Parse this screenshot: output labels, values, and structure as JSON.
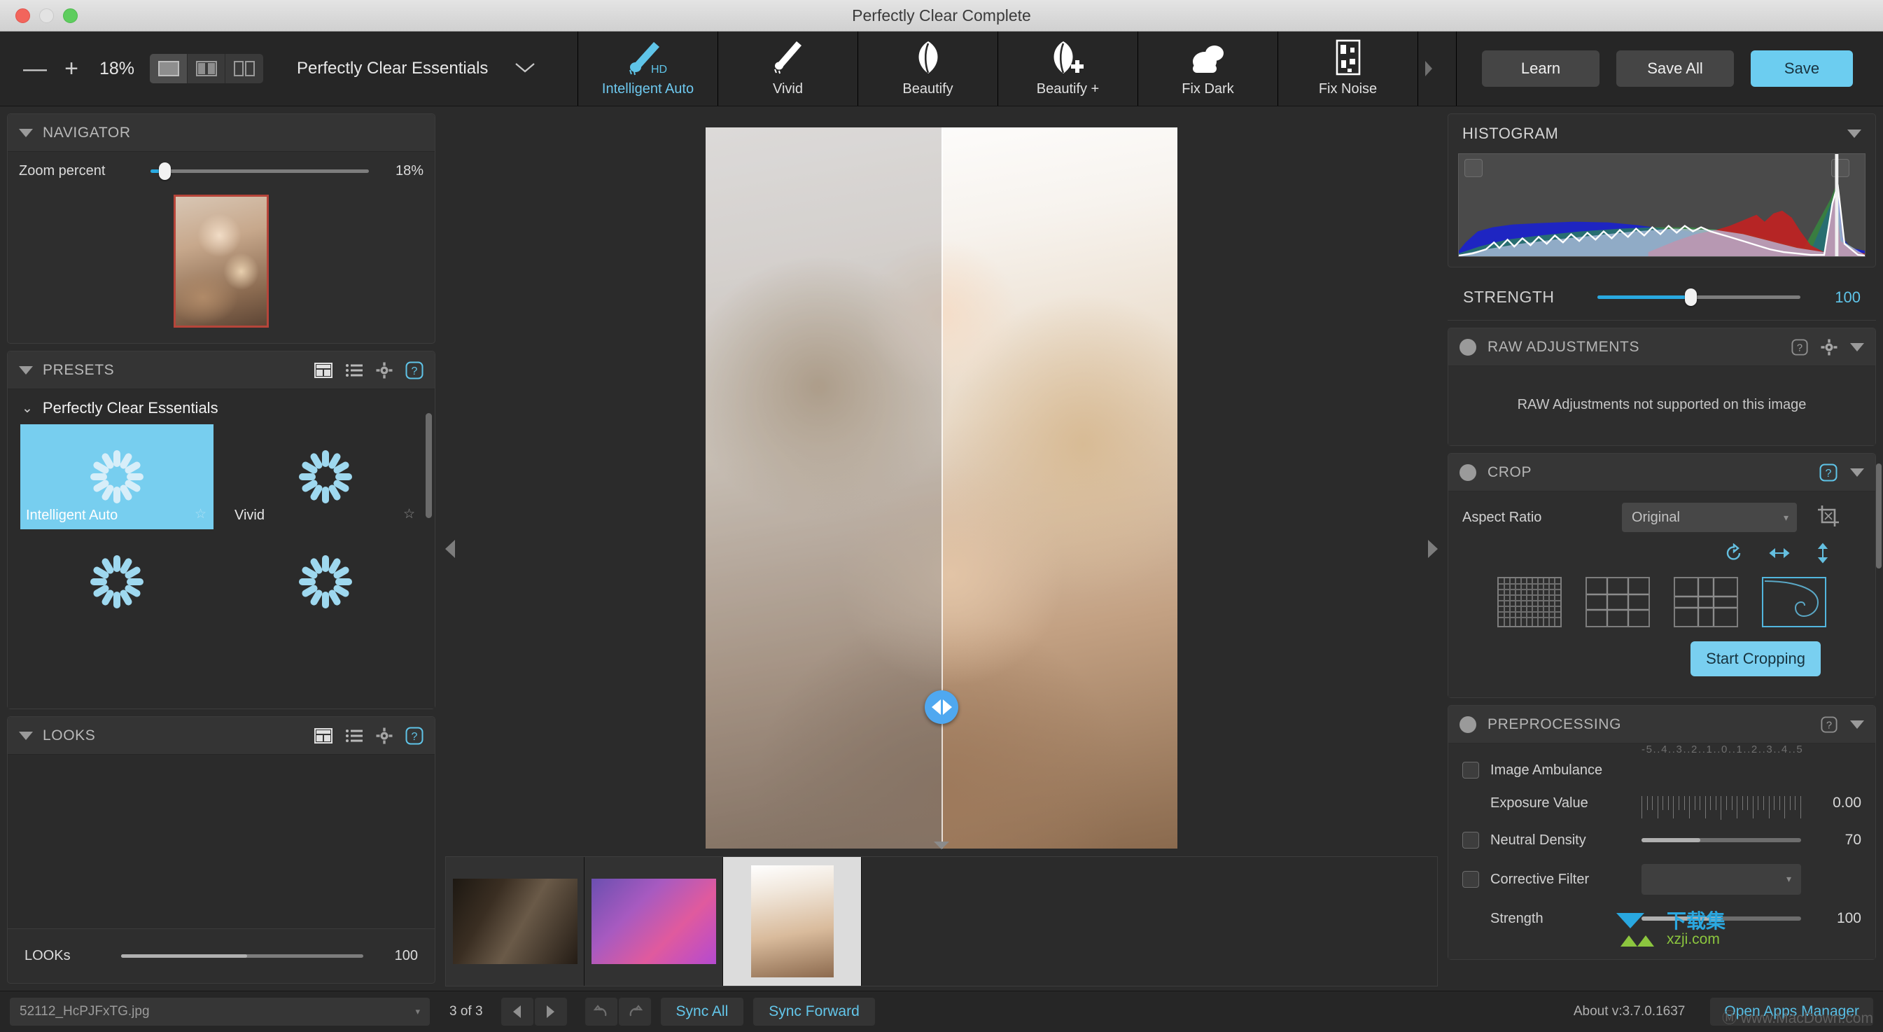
{
  "window": {
    "title": "Perfectly Clear Complete",
    "traffic": [
      "close",
      "minimize",
      "maximize"
    ]
  },
  "toolbar": {
    "zoom_out_label": "—",
    "zoom_in_label": "+",
    "zoom_percent": "18%",
    "view_modes": [
      {
        "name": "single-view",
        "active": true
      },
      {
        "name": "split-view",
        "active": false
      },
      {
        "name": "side-by-side-view",
        "active": false
      }
    ],
    "preset_name": "Perfectly Clear Essentials",
    "tabs": [
      {
        "label": "Intelligent Auto",
        "icon": "brush-hd-icon",
        "active": true
      },
      {
        "label": "Vivid",
        "icon": "brush-icon",
        "active": false
      },
      {
        "label": "Beautify",
        "icon": "leaf-icon",
        "active": false
      },
      {
        "label": "Beautify +",
        "icon": "leaf-plus-icon",
        "active": false
      },
      {
        "label": "Fix Dark",
        "icon": "clouds-icon",
        "active": false
      },
      {
        "label": "Fix Noise",
        "icon": "noise-icon",
        "active": false
      }
    ],
    "buttons": {
      "learn": "Learn",
      "save_all": "Save All",
      "save": "Save"
    },
    "accent_color": "#6ccdf0"
  },
  "left_panel": {
    "navigator": {
      "title": "NAVIGATOR",
      "zoom_label": "Zoom percent",
      "zoom_value": "18%",
      "zoom_fill_percent": 6
    },
    "presets": {
      "title": "PRESETS",
      "icons": [
        "grid-view-icon",
        "list-view-icon",
        "gear-icon",
        "help-icon"
      ],
      "group": "Perfectly Clear Essentials",
      "items": [
        {
          "label": "Intelligent Auto",
          "selected": true,
          "favorite": false
        },
        {
          "label": "Vivid",
          "selected": false,
          "favorite": false
        },
        {
          "label": "",
          "selected": false,
          "favorite": false
        },
        {
          "label": "",
          "selected": false,
          "favorite": false
        }
      ]
    },
    "looks": {
      "title": "LOOKS",
      "icons": [
        "grid-view-icon",
        "list-view-icon",
        "gear-icon",
        "help-icon"
      ],
      "slider_label": "LOOKs",
      "slider_value": "100",
      "slider_fill_percent": 52
    }
  },
  "viewer": {
    "split_handle": "compare-split-handle",
    "filmstrip": [
      {
        "name": "thumb-1",
        "selected": false
      },
      {
        "name": "thumb-2",
        "selected": false
      },
      {
        "name": "thumb-3",
        "selected": true
      }
    ]
  },
  "right_panel": {
    "histogram": {
      "title": "HISTOGRAM"
    },
    "strength": {
      "label": "STRENGTH",
      "value": "100",
      "fill_percent": 48
    },
    "raw_adjustments": {
      "title": "RAW ADJUSTMENTS",
      "note": "RAW Adjustments not supported on this image"
    },
    "crop": {
      "title": "CROP",
      "aspect_ratio_label": "Aspect Ratio",
      "aspect_ratio_value": "Original",
      "transform_icons": [
        "rotate-icon",
        "flip-horizontal-icon",
        "flip-vertical-icon"
      ],
      "overlays": [
        {
          "name": "fine-grid-overlay",
          "selected": false
        },
        {
          "name": "thirds-grid-overlay",
          "selected": false
        },
        {
          "name": "golden-grid-overlay",
          "selected": false
        },
        {
          "name": "golden-spiral-overlay",
          "selected": true
        }
      ],
      "start_button": "Start Cropping"
    },
    "preprocessing": {
      "title": "PREPROCESSING",
      "rows": [
        {
          "label": "Image Ambulance",
          "type": "checkbox",
          "checked": false
        },
        {
          "label": "Exposure Value",
          "type": "ev-scale",
          "value": "0.00",
          "scale": "-5..4..3..2..1..0..1..2..3..4..5"
        },
        {
          "label": "Neutral Density",
          "type": "slider-checkbox",
          "checked": false,
          "value": "70",
          "fill_percent": 37
        },
        {
          "label": "Corrective Filter",
          "type": "select-checkbox",
          "checked": false,
          "value": ""
        },
        {
          "label": "Strength",
          "type": "slider",
          "value": "100",
          "fill_percent": 50
        }
      ]
    },
    "watermark": {
      "cn": "下载集",
      "en": "xzji.com"
    }
  },
  "statusbar": {
    "filename": "52112_HcPJFxTG.jpg",
    "counter": "3 of 3",
    "prev": "previous-image",
    "next": "next-image",
    "undo": "undo",
    "redo": "redo",
    "sync_all": "Sync All",
    "sync_forward": "Sync Forward",
    "about": "About v:3.7.0.1637",
    "open_apps_manager": "Open Apps Manager",
    "overlay_text": "Ⓜ www.MacDown.com"
  }
}
